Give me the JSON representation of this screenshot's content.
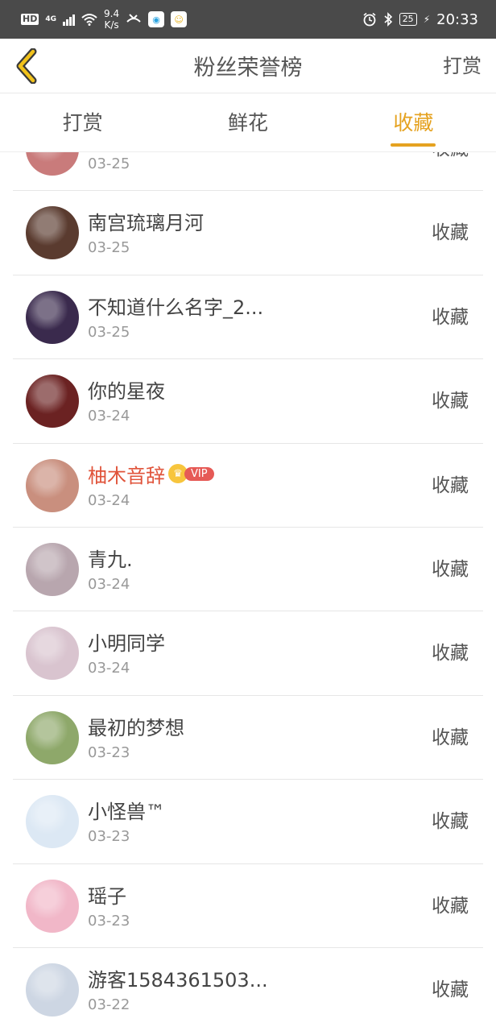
{
  "status_bar": {
    "hd": "HD",
    "network": "4G",
    "speed_value": "9.4",
    "speed_unit": "K/s",
    "battery": "25",
    "time": "20:33"
  },
  "header": {
    "title": "粉丝荣誉榜",
    "right_action": "打赏"
  },
  "tabs": [
    {
      "label": "打赏",
      "active": false
    },
    {
      "label": "鲜花",
      "active": false
    },
    {
      "label": "收藏",
      "active": true
    }
  ],
  "rows": [
    {
      "name": "",
      "date": "03-25",
      "action": "收藏",
      "avatar_color": "#c97b7b"
    },
    {
      "name": "南宫琉璃月河",
      "date": "03-25",
      "action": "收藏",
      "avatar_color": "#5a3b2f"
    },
    {
      "name": "不知道什么名字_2...",
      "date": "03-25",
      "action": "收藏",
      "avatar_color": "#3a2a4d"
    },
    {
      "name": "你的星夜",
      "date": "03-24",
      "action": "收藏",
      "avatar_color": "#6b2222"
    },
    {
      "name": "柚木音辞",
      "date": "03-24",
      "action": "收藏",
      "avatar_color": "#c98f7e",
      "vip": "VIP"
    },
    {
      "name": "青九.",
      "date": "03-24",
      "action": "收藏",
      "avatar_color": "#b8a6ae"
    },
    {
      "name": "小明同学",
      "date": "03-24",
      "action": "收藏",
      "avatar_color": "#d9c4cf"
    },
    {
      "name": "最初的梦想",
      "date": "03-23",
      "action": "收藏",
      "avatar_color": "#8ea86a"
    },
    {
      "name": "小怪兽™",
      "date": "03-23",
      "action": "收藏",
      "avatar_color": "#dce8f4"
    },
    {
      "name": "瑶子",
      "date": "03-23",
      "action": "收藏",
      "avatar_color": "#f1b7c8"
    },
    {
      "name": "游客1584361503...",
      "date": "03-22",
      "action": "收藏",
      "avatar_color": "#cdd6e3"
    }
  ]
}
